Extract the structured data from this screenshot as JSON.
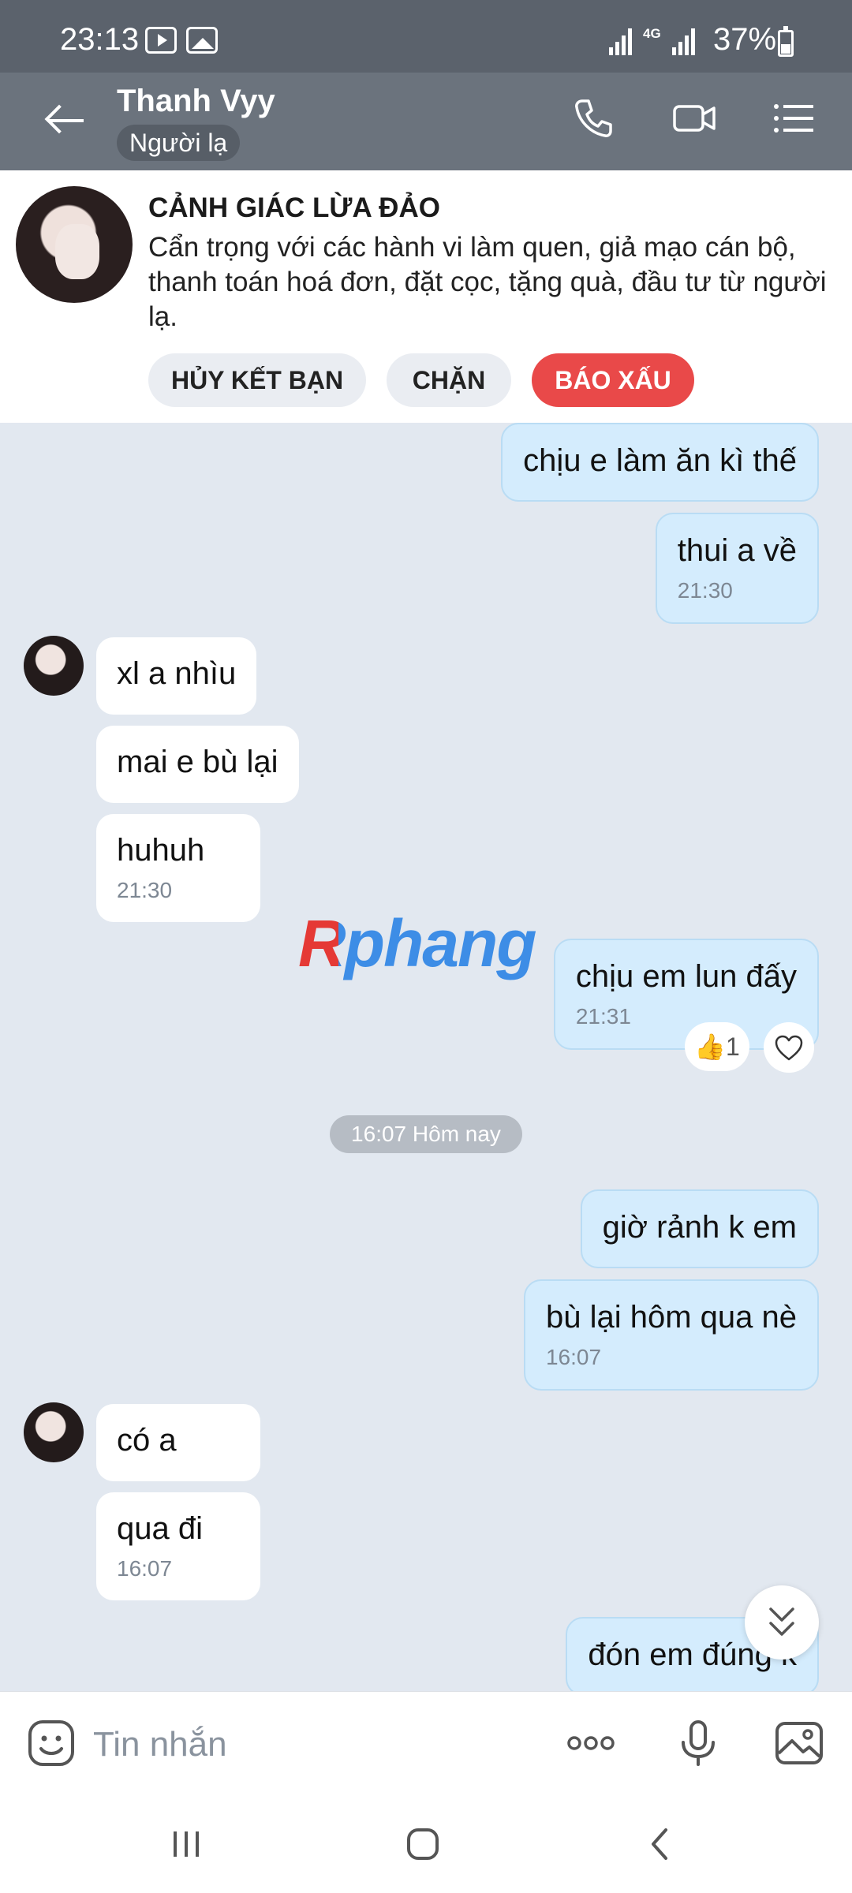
{
  "status_bar": {
    "time": "23:13",
    "network": "4G",
    "battery": "37%"
  },
  "header": {
    "name": "Thanh Vyy",
    "tag": "Người lạ"
  },
  "warning": {
    "title": "CẢNH GIÁC LỪA ĐẢO",
    "text": "Cẩn trọng với các hành vi làm quen, giả mạo cán bộ, thanh toán hoá đơn, đặt cọc, tặng quà, đầu tư từ người lạ.",
    "unfriend": "HỦY KẾT BẠN",
    "block": "CHẶN",
    "report": "BÁO XẤU"
  },
  "messages": {
    "m1": {
      "text": "chịu e làm ăn kì thế"
    },
    "m2": {
      "text": "thui a về",
      "time": "21:30"
    },
    "m3": {
      "text": "xl a nhìu"
    },
    "m4": {
      "text": "mai e bù lại"
    },
    "m5": {
      "text": "huhuh",
      "time": "21:30"
    },
    "m6": {
      "text": "chịu em lun đấy",
      "time": "21:31",
      "reaction": "👍1"
    },
    "date_divider": "16:07 Hôm nay",
    "m7": {
      "text": "giờ rảnh k em"
    },
    "m8": {
      "text": "bù lại hôm qua nè",
      "time": "16:07"
    },
    "m9": {
      "text": "có a"
    },
    "m10": {
      "text": "qua đi",
      "time": "16:07"
    },
    "m11": {
      "text": "đón em đúng k"
    }
  },
  "watermark": "Rphang",
  "input": {
    "placeholder": "Tin nhắn"
  }
}
